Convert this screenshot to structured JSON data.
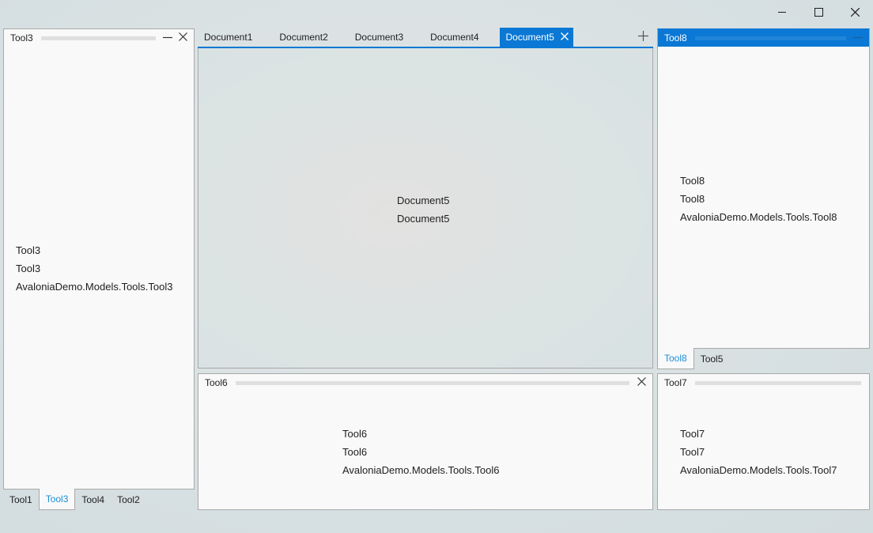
{
  "window": {
    "controls": {
      "minimize": "minimize-icon",
      "maximize": "maximize-icon",
      "close": "close-icon"
    }
  },
  "left_tool": {
    "title": "Tool3",
    "lines": [
      "Tool3",
      "Tool3",
      "AvaloniaDemo.Models.Tools.Tool3"
    ],
    "tabs": [
      "Tool1",
      "Tool3",
      "Tool4",
      "Tool2"
    ],
    "active_tab": "Tool3"
  },
  "documents": {
    "tabs": [
      "Document1",
      "Document2",
      "Document3",
      "Document4",
      "Document5"
    ],
    "active_tab": "Document5",
    "content_lines": [
      "Document5",
      "Document5"
    ]
  },
  "bottom_tool": {
    "title": "Tool6",
    "lines": [
      "Tool6",
      "Tool6",
      "AvaloniaDemo.Models.Tools.Tool6"
    ]
  },
  "right_tool": {
    "title": "Tool8",
    "lines": [
      "Tool8",
      "Tool8",
      "AvaloniaDemo.Models.Tools.Tool8"
    ],
    "tabs": [
      "Tool8",
      "Tool5"
    ],
    "active_tab": "Tool8"
  },
  "right_bottom_tool": {
    "title": "Tool7",
    "lines": [
      "Tool7",
      "Tool7",
      "AvaloniaDemo.Models.Tools.Tool7"
    ]
  },
  "colors": {
    "accent": "#0a78d4",
    "active_tab_text": "#1c8fd6",
    "panel_bg": "#f9f9f9",
    "border": "#a9a9a9"
  }
}
